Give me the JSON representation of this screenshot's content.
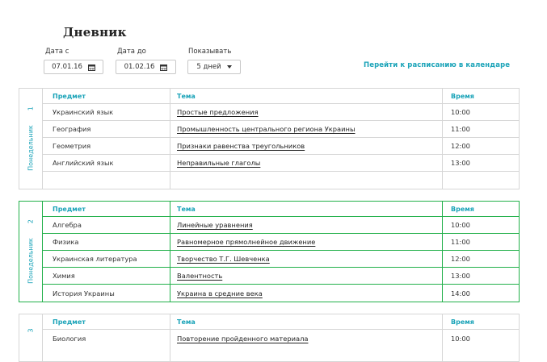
{
  "page": {
    "title": "Дневник"
  },
  "filters": {
    "date_from_label": "Дата с",
    "date_from_value": "07.01.16",
    "date_to_label": "Дата до",
    "date_to_value": "01.02.16",
    "show_label": "Показывать",
    "show_value": "5 дней",
    "calendar_link": "Перейти к расписанию в календаре"
  },
  "colors": {
    "accent": "#1aa3b8",
    "active_border": "#22b04a",
    "border": "#d6d6d6"
  },
  "days": [
    {
      "number": "1",
      "weekday": "Понедельник",
      "active": false,
      "headers": {
        "subject": "Предмет",
        "theme": "Тема",
        "time": "Время"
      },
      "lessons": [
        {
          "subject": "Украинский язык",
          "theme": "Простые предложения",
          "time": "10:00"
        },
        {
          "subject": "География",
          "theme": "Промышленность центрального региона Украины",
          "time": "11:00"
        },
        {
          "subject": "Геометрия",
          "theme": "Признаки равенства треугольников",
          "time": "12:00"
        },
        {
          "subject": "Английский язык",
          "theme": "Неправильные глаголы",
          "time": "13:00"
        },
        {
          "subject": "",
          "theme": "",
          "time": ""
        }
      ]
    },
    {
      "number": "2",
      "weekday": "Понедельник",
      "active": true,
      "headers": {
        "subject": "Предмет",
        "theme": "Тема",
        "time": "Время"
      },
      "lessons": [
        {
          "subject": "Алгебра",
          "theme": "Линейные уравнения",
          "time": "10:00"
        },
        {
          "subject": "Физика",
          "theme": "Равномерное прямолнейное движение",
          "time": "11:00"
        },
        {
          "subject": "Украинская литература",
          "theme": "Творчество Т.Г. Шевченка",
          "time": "12:00"
        },
        {
          "subject": "Химия",
          "theme": "Валентность",
          "time": "13:00"
        },
        {
          "subject": "История Украины",
          "theme": "Украина в средние века",
          "time": "14:00"
        }
      ]
    },
    {
      "number": "3",
      "weekday": "",
      "active": false,
      "headers": {
        "subject": "Предмет",
        "theme": "Тема",
        "time": "Время"
      },
      "lessons": [
        {
          "subject": "Биология",
          "theme": "Повторение пройденного материала",
          "time": "10:00"
        }
      ]
    }
  ]
}
